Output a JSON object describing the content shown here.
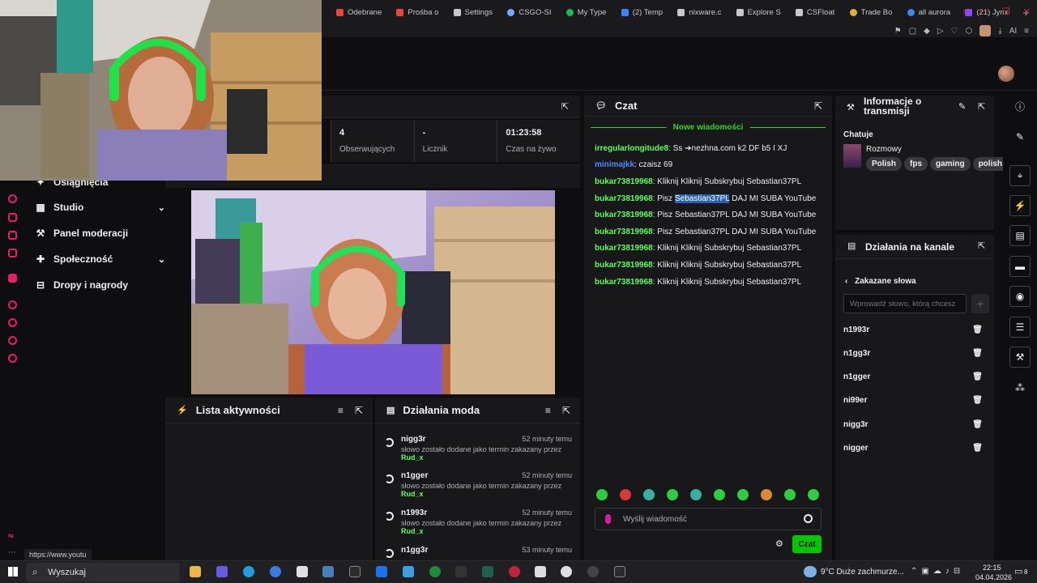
{
  "browser": {
    "tabs": [
      {
        "label": "Odebrane",
        "color": "#e8453c"
      },
      {
        "label": "Prośba o",
        "color": "#e8453c"
      },
      {
        "label": "Settings",
        "color": "#c8c8cc"
      },
      {
        "label": "CSGO-SI",
        "color": "#7aa7ff"
      },
      {
        "label": "My Type",
        "color": "#1db954"
      },
      {
        "label": "(2) Temp",
        "color": "#3b82f6"
      },
      {
        "label": "nixware.c",
        "color": "#c8c8cc"
      },
      {
        "label": "Explore S",
        "color": "#c8c8cc"
      },
      {
        "label": "CSFloat",
        "color": "#c8c8cc"
      },
      {
        "label": "Trade Bo",
        "color": "#e0b030"
      },
      {
        "label": "all aurora",
        "color": "#4285f4"
      },
      {
        "label": "(21) Jynx",
        "color": "#9146ff"
      }
    ],
    "new_tab": "+",
    "ai_label": "AI"
  },
  "sidebar": {
    "items": [
      {
        "label": "Osiągnięcia",
        "icon": "trophy-icon"
      },
      {
        "label": "Studio",
        "icon": "studio-icon",
        "chevron": "⌄"
      },
      {
        "label": "Panel moderacji",
        "icon": "wrench-icon"
      },
      {
        "label": "Społeczność",
        "icon": "community-icon",
        "chevron": "⌄"
      },
      {
        "label": "Dropy i nagrody",
        "icon": "gift-icon"
      }
    ]
  },
  "stats": [
    {
      "value": "4",
      "label": "Obserwujących"
    },
    {
      "value": "-",
      "label": "Licznik"
    },
    {
      "value": "01:23:58",
      "label": "Czas na żywo"
    }
  ],
  "activity": {
    "title": "Lista aktywności"
  },
  "mod_actions": {
    "title": "Działania moda",
    "entries": [
      {
        "word": "nigg3r",
        "time": "52 minuty temu",
        "desc": "słowo zostało dodane jako termin zakazany przez",
        "by": "Rud_x"
      },
      {
        "word": "n1gger",
        "time": "52 minuty temu",
        "desc": "słowo zostało dodane jako termin zakazany przez",
        "by": "Rud_x"
      },
      {
        "word": "n1993r",
        "time": "52 minuty temu",
        "desc": "słowo zostało dodane jako termin zakazany przez",
        "by": "Rud_x"
      },
      {
        "word": "n1gg3r",
        "time": "53 minuty temu",
        "desc": "",
        "by": ""
      }
    ]
  },
  "chat": {
    "title": "Czat",
    "new_messages": "Nowe wiadomości",
    "messages": [
      {
        "user": "irregularlongitude8",
        "color": "#5cff5c",
        "text": ": Ss ➔nezhna.com k2 DF b5 I XJ"
      },
      {
        "user": "minimajkk",
        "color": "#4f8bff",
        "text": ": czaisz 69"
      },
      {
        "user": "bukar73819968",
        "color": "#5cff5c",
        "text": ": Kliknij Kliknij Subskrybuj Sebastian37PL"
      },
      {
        "user": "bukar73819968",
        "color": "#5cff5c",
        "text_pre": ": Pisz ",
        "highlight": "Sebastian37PL",
        "text_post": " DAJ MI SUBA YouTube"
      },
      {
        "user": "bukar73819968",
        "color": "#5cff5c",
        "text": ": Pisz Sebastian37PL DAJ MI SUBA YouTube"
      },
      {
        "user": "bukar73819968",
        "color": "#5cff5c",
        "text": ": Pisz Sebastian37PL DAJ MI SUBA YouTube"
      },
      {
        "user": "bukar73819968",
        "color": "#5cff5c",
        "text": ": Kliknij Kliknij Subskrybuj Sebastian37PL"
      },
      {
        "user": "bukar73819968",
        "color": "#5cff5c",
        "text": ": Kliknij Kliknij Subskrybuj Sebastian37PL"
      },
      {
        "user": "bukar73819968",
        "color": "#5cff5c",
        "text": ": Kliknij Kliknij Subskrybuj Sebastian37PL"
      }
    ],
    "input_placeholder": "Wyślij wiadomość",
    "send_label": "Czat"
  },
  "stream_info": {
    "title": "Informacje o transmisji",
    "status_label": "Chatuje",
    "category": "Rozmowy",
    "tags": [
      "Polish",
      "fps",
      "gaming",
      "polish"
    ]
  },
  "channel_actions": {
    "title": "Działania na kanale",
    "back_label": "Zakazane słowa",
    "input_placeholder": "Wprowadź słowo, którą chcesz",
    "add_label": "+",
    "words": [
      "n1993r",
      "n1gg3r",
      "n1gger",
      "ni99er",
      "nigg3r",
      "nigger"
    ]
  },
  "status_url": "https://www.youtu",
  "taskbar": {
    "search_label": "Wyszukaj",
    "weather": "9°C  Duże zachmurze...",
    "time": "22:15",
    "date": "04.04.2026",
    "notif_count": "8"
  },
  "colors": {
    "accent_green": "#00c800",
    "panel_bg": "#18181b",
    "page_bg": "#0e0e10"
  }
}
